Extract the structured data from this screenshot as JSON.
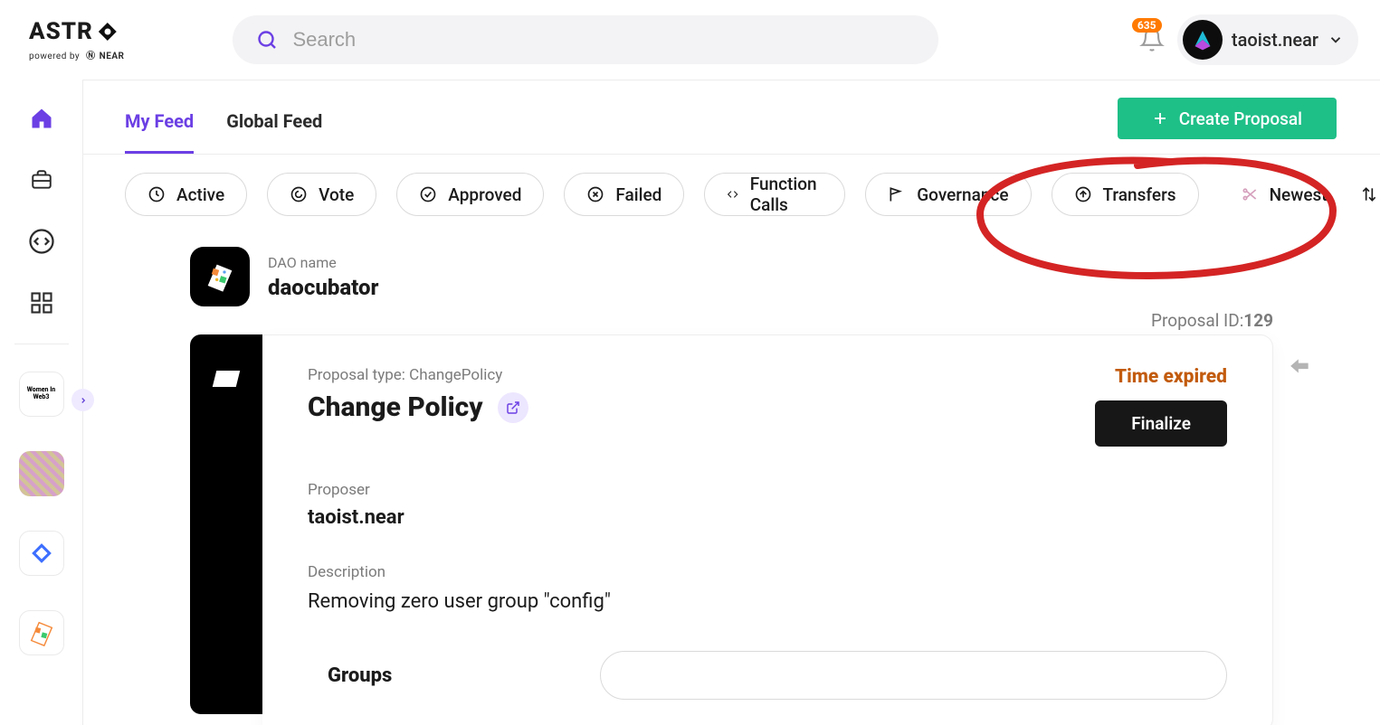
{
  "header": {
    "logo_text": "ASTR",
    "powered_by": "powered by",
    "brand": "NEAR",
    "search_placeholder": "Search",
    "notif_count": "635",
    "user_name": "taoist.near"
  },
  "tabs": {
    "my_feed": "My Feed",
    "global_feed": "Global Feed"
  },
  "create_button": "Create Proposal",
  "filters": {
    "active": "Active",
    "vote": "Vote",
    "approved": "Approved",
    "failed": "Failed",
    "fn_calls": "Function Calls",
    "governance": "Governance",
    "transfers": "Transfers",
    "newest": "Newest"
  },
  "dao": {
    "label": "DAO name",
    "name": "daocubator"
  },
  "proposal": {
    "id_label": "Proposal ID:",
    "id_value": "129",
    "type_label": "Proposal type: ",
    "type_value": "ChangePolicy",
    "title": "Change Policy",
    "status": "Time expired",
    "finalize": "Finalize",
    "proposer_label": "Proposer",
    "proposer": "taoist.near",
    "description_label": "Description",
    "description": "Removing zero user group \"config\"",
    "groups_label": "Groups"
  },
  "sidebar_text": {
    "women_web3": "Women In Web3"
  }
}
